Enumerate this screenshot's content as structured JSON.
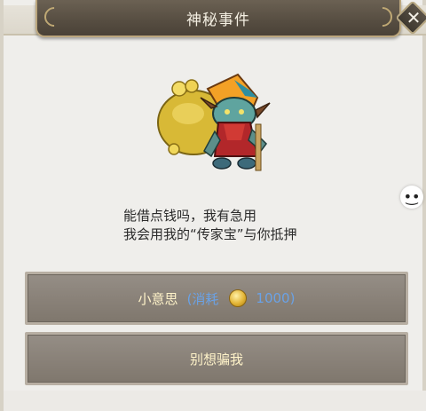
{
  "dialog": {
    "title": "神秘事件",
    "close_label": "✕",
    "message_lines": [
      "能借点钱吗，我有急用",
      "我会用我的“传家宝”与你抵押"
    ],
    "side_emoji": "•͜•"
  },
  "options": [
    {
      "label": "小意思",
      "cost_prefix": "(消耗",
      "cost_amount": "1000)",
      "cost_icon": "gold-coin-icon"
    },
    {
      "label": "别想骗我"
    }
  ],
  "colors": {
    "title_plate": "#564d41",
    "option_bg": "#8a8279",
    "option_text": "#fff3c9",
    "cost_text": "#6aa2e6"
  }
}
